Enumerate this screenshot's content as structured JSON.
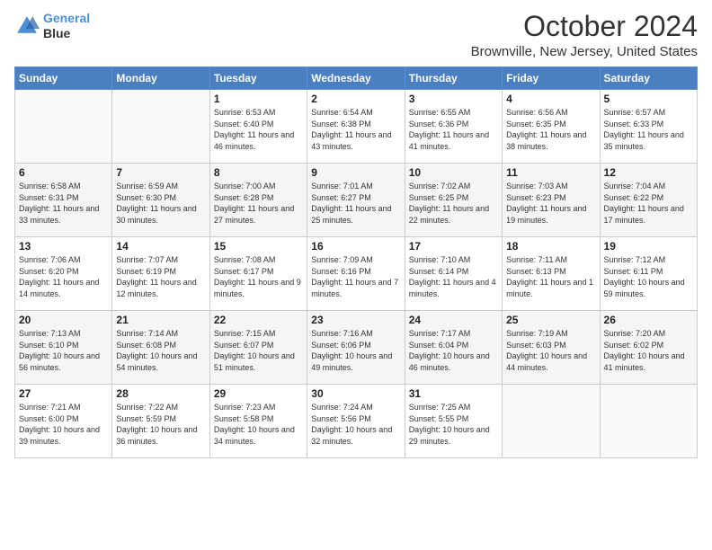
{
  "logo": {
    "line1": "General",
    "line2": "Blue"
  },
  "title": "October 2024",
  "subtitle": "Brownville, New Jersey, United States",
  "weekdays": [
    "Sunday",
    "Monday",
    "Tuesday",
    "Wednesday",
    "Thursday",
    "Friday",
    "Saturday"
  ],
  "weeks": [
    [
      {
        "day": "",
        "sunrise": "",
        "sunset": "",
        "daylight": ""
      },
      {
        "day": "",
        "sunrise": "",
        "sunset": "",
        "daylight": ""
      },
      {
        "day": "1",
        "sunrise": "Sunrise: 6:53 AM",
        "sunset": "Sunset: 6:40 PM",
        "daylight": "Daylight: 11 hours and 46 minutes."
      },
      {
        "day": "2",
        "sunrise": "Sunrise: 6:54 AM",
        "sunset": "Sunset: 6:38 PM",
        "daylight": "Daylight: 11 hours and 43 minutes."
      },
      {
        "day": "3",
        "sunrise": "Sunrise: 6:55 AM",
        "sunset": "Sunset: 6:36 PM",
        "daylight": "Daylight: 11 hours and 41 minutes."
      },
      {
        "day": "4",
        "sunrise": "Sunrise: 6:56 AM",
        "sunset": "Sunset: 6:35 PM",
        "daylight": "Daylight: 11 hours and 38 minutes."
      },
      {
        "day": "5",
        "sunrise": "Sunrise: 6:57 AM",
        "sunset": "Sunset: 6:33 PM",
        "daylight": "Daylight: 11 hours and 35 minutes."
      }
    ],
    [
      {
        "day": "6",
        "sunrise": "Sunrise: 6:58 AM",
        "sunset": "Sunset: 6:31 PM",
        "daylight": "Daylight: 11 hours and 33 minutes."
      },
      {
        "day": "7",
        "sunrise": "Sunrise: 6:59 AM",
        "sunset": "Sunset: 6:30 PM",
        "daylight": "Daylight: 11 hours and 30 minutes."
      },
      {
        "day": "8",
        "sunrise": "Sunrise: 7:00 AM",
        "sunset": "Sunset: 6:28 PM",
        "daylight": "Daylight: 11 hours and 27 minutes."
      },
      {
        "day": "9",
        "sunrise": "Sunrise: 7:01 AM",
        "sunset": "Sunset: 6:27 PM",
        "daylight": "Daylight: 11 hours and 25 minutes."
      },
      {
        "day": "10",
        "sunrise": "Sunrise: 7:02 AM",
        "sunset": "Sunset: 6:25 PM",
        "daylight": "Daylight: 11 hours and 22 minutes."
      },
      {
        "day": "11",
        "sunrise": "Sunrise: 7:03 AM",
        "sunset": "Sunset: 6:23 PM",
        "daylight": "Daylight: 11 hours and 19 minutes."
      },
      {
        "day": "12",
        "sunrise": "Sunrise: 7:04 AM",
        "sunset": "Sunset: 6:22 PM",
        "daylight": "Daylight: 11 hours and 17 minutes."
      }
    ],
    [
      {
        "day": "13",
        "sunrise": "Sunrise: 7:06 AM",
        "sunset": "Sunset: 6:20 PM",
        "daylight": "Daylight: 11 hours and 14 minutes."
      },
      {
        "day": "14",
        "sunrise": "Sunrise: 7:07 AM",
        "sunset": "Sunset: 6:19 PM",
        "daylight": "Daylight: 11 hours and 12 minutes."
      },
      {
        "day": "15",
        "sunrise": "Sunrise: 7:08 AM",
        "sunset": "Sunset: 6:17 PM",
        "daylight": "Daylight: 11 hours and 9 minutes."
      },
      {
        "day": "16",
        "sunrise": "Sunrise: 7:09 AM",
        "sunset": "Sunset: 6:16 PM",
        "daylight": "Daylight: 11 hours and 7 minutes."
      },
      {
        "day": "17",
        "sunrise": "Sunrise: 7:10 AM",
        "sunset": "Sunset: 6:14 PM",
        "daylight": "Daylight: 11 hours and 4 minutes."
      },
      {
        "day": "18",
        "sunrise": "Sunrise: 7:11 AM",
        "sunset": "Sunset: 6:13 PM",
        "daylight": "Daylight: 11 hours and 1 minute."
      },
      {
        "day": "19",
        "sunrise": "Sunrise: 7:12 AM",
        "sunset": "Sunset: 6:11 PM",
        "daylight": "Daylight: 10 hours and 59 minutes."
      }
    ],
    [
      {
        "day": "20",
        "sunrise": "Sunrise: 7:13 AM",
        "sunset": "Sunset: 6:10 PM",
        "daylight": "Daylight: 10 hours and 56 minutes."
      },
      {
        "day": "21",
        "sunrise": "Sunrise: 7:14 AM",
        "sunset": "Sunset: 6:08 PM",
        "daylight": "Daylight: 10 hours and 54 minutes."
      },
      {
        "day": "22",
        "sunrise": "Sunrise: 7:15 AM",
        "sunset": "Sunset: 6:07 PM",
        "daylight": "Daylight: 10 hours and 51 minutes."
      },
      {
        "day": "23",
        "sunrise": "Sunrise: 7:16 AM",
        "sunset": "Sunset: 6:06 PM",
        "daylight": "Daylight: 10 hours and 49 minutes."
      },
      {
        "day": "24",
        "sunrise": "Sunrise: 7:17 AM",
        "sunset": "Sunset: 6:04 PM",
        "daylight": "Daylight: 10 hours and 46 minutes."
      },
      {
        "day": "25",
        "sunrise": "Sunrise: 7:19 AM",
        "sunset": "Sunset: 6:03 PM",
        "daylight": "Daylight: 10 hours and 44 minutes."
      },
      {
        "day": "26",
        "sunrise": "Sunrise: 7:20 AM",
        "sunset": "Sunset: 6:02 PM",
        "daylight": "Daylight: 10 hours and 41 minutes."
      }
    ],
    [
      {
        "day": "27",
        "sunrise": "Sunrise: 7:21 AM",
        "sunset": "Sunset: 6:00 PM",
        "daylight": "Daylight: 10 hours and 39 minutes."
      },
      {
        "day": "28",
        "sunrise": "Sunrise: 7:22 AM",
        "sunset": "Sunset: 5:59 PM",
        "daylight": "Daylight: 10 hours and 36 minutes."
      },
      {
        "day": "29",
        "sunrise": "Sunrise: 7:23 AM",
        "sunset": "Sunset: 5:58 PM",
        "daylight": "Daylight: 10 hours and 34 minutes."
      },
      {
        "day": "30",
        "sunrise": "Sunrise: 7:24 AM",
        "sunset": "Sunset: 5:56 PM",
        "daylight": "Daylight: 10 hours and 32 minutes."
      },
      {
        "day": "31",
        "sunrise": "Sunrise: 7:25 AM",
        "sunset": "Sunset: 5:55 PM",
        "daylight": "Daylight: 10 hours and 29 minutes."
      },
      {
        "day": "",
        "sunrise": "",
        "sunset": "",
        "daylight": ""
      },
      {
        "day": "",
        "sunrise": "",
        "sunset": "",
        "daylight": ""
      }
    ]
  ]
}
